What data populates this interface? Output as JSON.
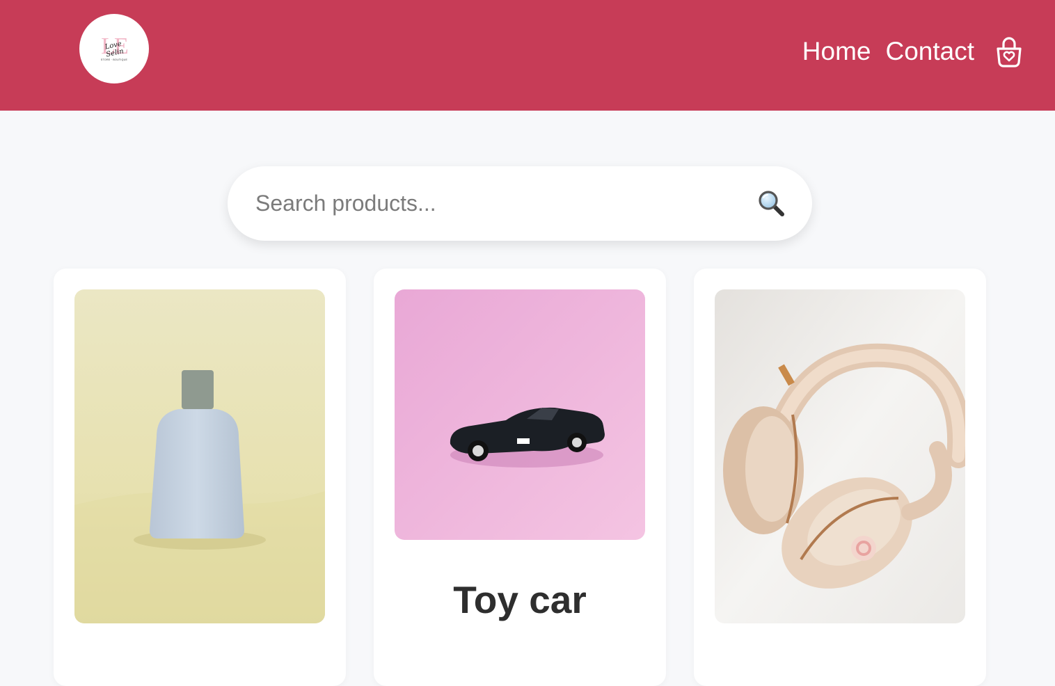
{
  "header": {
    "background": "#c73c57",
    "logo": {
      "letters": "LE",
      "script": "Love Selin",
      "tagline": "STORE · BOUTIQUE",
      "alt": "store logo"
    },
    "nav": [
      {
        "label": "Home"
      },
      {
        "label": "Contact"
      }
    ],
    "cart_icon": "shopping-bag-heart-icon"
  },
  "search": {
    "placeholder": "Search products...",
    "value": "",
    "icon": "magnifier-icon"
  },
  "products": [
    {
      "title": "",
      "image": "perfume-bottle"
    },
    {
      "title": "Toy car",
      "image": "toy-car"
    },
    {
      "title": "",
      "image": "headphones"
    }
  ]
}
